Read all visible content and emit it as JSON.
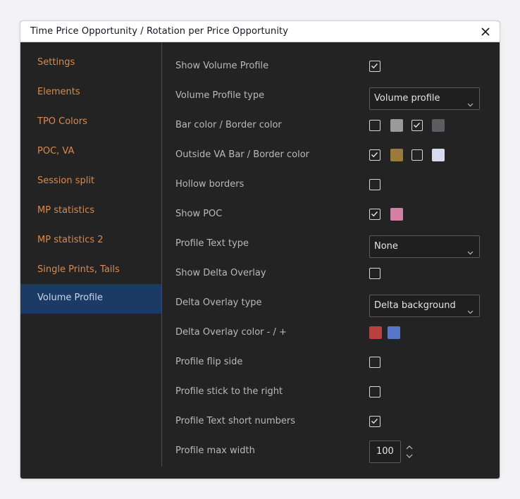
{
  "dialog": {
    "title": "Time Price Opportunity / Rotation per Price Opportunity"
  },
  "sidebar": {
    "items": [
      {
        "label": "Settings",
        "active": false
      },
      {
        "label": "Elements",
        "active": false
      },
      {
        "label": "TPO Colors",
        "active": false
      },
      {
        "label": "POC, VA",
        "active": false
      },
      {
        "label": "Session split",
        "active": false
      },
      {
        "label": "MP statistics",
        "active": false
      },
      {
        "label": "MP statistics 2",
        "active": false
      },
      {
        "label": "Single Prints, Tails",
        "active": false
      },
      {
        "label": "Volume Profile",
        "active": true
      }
    ]
  },
  "settings": {
    "show_volume_profile": {
      "label": "Show Volume Profile",
      "checked": true
    },
    "volume_profile_type": {
      "label": "Volume Profile type",
      "value": "Volume profile"
    },
    "bar_color": {
      "label": "Bar color / Border color",
      "bar_checked": false,
      "bar_color": "#9a9a9a",
      "border_checked": true,
      "border_color": "#5c5d60"
    },
    "outside_va": {
      "label": "Outside VA Bar / Border color",
      "bar_checked": true,
      "bar_color": "#9c7a3c",
      "border_checked": false,
      "border_color": "#d7dbeb"
    },
    "hollow_borders": {
      "label": "Hollow borders",
      "checked": false
    },
    "show_poc": {
      "label": "Show POC",
      "checked": true,
      "color": "#d37fa6"
    },
    "profile_text_type": {
      "label": "Profile Text type",
      "value": "None"
    },
    "show_delta_overlay": {
      "label": "Show Delta Overlay",
      "checked": false
    },
    "delta_overlay_type": {
      "label": "Delta Overlay type",
      "value": "Delta background"
    },
    "delta_overlay_color": {
      "label": "Delta Overlay color - / +",
      "neg_color": "#b8413f",
      "pos_color": "#5a76c8"
    },
    "profile_flip_side": {
      "label": "Profile flip side",
      "checked": false
    },
    "profile_stick_right": {
      "label": "Profile stick to the right",
      "checked": false
    },
    "profile_text_short": {
      "label": "Profile Text short numbers",
      "checked": true
    },
    "profile_max_width": {
      "label": "Profile max width",
      "value": "100"
    }
  },
  "icons": {
    "close": "close-icon",
    "checkmark": "checkmark-icon",
    "chevron": "chevron-down-icon",
    "stepper": "stepper-arrows-icon"
  }
}
